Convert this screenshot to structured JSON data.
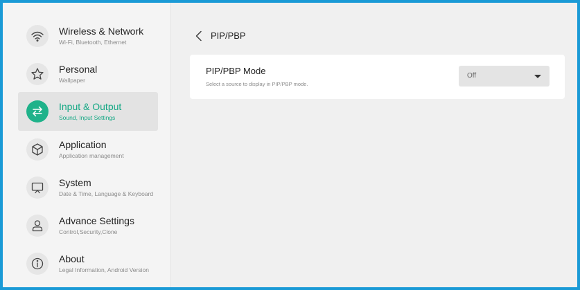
{
  "sidebar": {
    "items": [
      {
        "title": "Wireless & Network",
        "subtitle": "Wi-Fi, Bluetooth, Ethernet",
        "icon": "wifi-icon"
      },
      {
        "title": "Personal",
        "subtitle": "Wallpaper",
        "icon": "star-icon"
      },
      {
        "title": "Input & Output",
        "subtitle": "Sound, Input Settings",
        "icon": "swap-arrows-icon"
      },
      {
        "title": "Application",
        "subtitle": "Application management",
        "icon": "cube-icon"
      },
      {
        "title": "System",
        "subtitle": "Date & Time, Language & Keyboard",
        "icon": "monitor-icon"
      },
      {
        "title": "Advance Settings",
        "subtitle": "Control,Security,Clone",
        "icon": "user-icon"
      },
      {
        "title": "About",
        "subtitle": "Legal Information, Android Version",
        "icon": "info-icon"
      }
    ],
    "active_index": 2
  },
  "header": {
    "title": "PIP/PBP"
  },
  "settings": {
    "pip_mode": {
      "title": "PIP/PBP Mode",
      "description": "Select a source to display in PIP/PBP mode.",
      "value": "Off"
    }
  },
  "colors": {
    "accent": "#1fb28a",
    "frame": "#1a9ad6"
  }
}
